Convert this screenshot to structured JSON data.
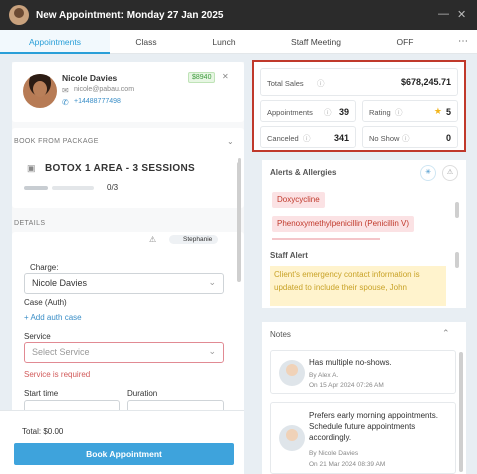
{
  "window": {
    "title": "New Appointment: Monday 27 Jan 2025"
  },
  "tabs": [
    "Appointments",
    "Class",
    "Lunch",
    "Staff Meeting",
    "OFF"
  ],
  "patient": {
    "name": "Nicole Davies",
    "email": "nicole@pabau.com",
    "phone": "+14488777498",
    "balance": "$8940"
  },
  "package": {
    "section_label": "BOOK FROM PACKAGE",
    "name": "BOTOX 1 AREA - 3 SESSIONS",
    "progress_text": "0/3",
    "progress_fraction": 0
  },
  "details": {
    "section_label": "DETAILS",
    "staff": "Stephanie",
    "charge_label": "Charge:",
    "charge_value": "Nicole Davies",
    "case_label": "Case (Auth)",
    "add_case": "+ Add auth case",
    "service_label": "Service",
    "service_placeholder": "Select Service",
    "service_error": "Service is required",
    "start_label": "Start time",
    "duration_label": "Duration"
  },
  "footer": {
    "total": "Total: $0.00",
    "book_button": "Book Appointment"
  },
  "stats": {
    "total_sales_label": "Total Sales",
    "total_sales_value": "$678,245.71",
    "appointments_label": "Appointments",
    "appointments_value": "39",
    "rating_label": "Rating",
    "rating_value": "5",
    "canceled_label": "Canceled",
    "canceled_value": "341",
    "noshow_label": "No Show",
    "noshow_value": "0"
  },
  "alerts": {
    "title": "Alerts & Allergies",
    "items": [
      "Doxycycline",
      "Phenoxymethylpenicillin (Penicillin V)"
    ],
    "staff_alert_title": "Staff Alert",
    "staff_alert_text": "Client's emergency contact information is updated to include their spouse, John"
  },
  "notes": {
    "title": "Notes",
    "items": [
      {
        "text": "Has multiple no-shows.",
        "author": "By Alex A.",
        "date": "On 15 Apr 2024 07:26 AM"
      },
      {
        "text": "Prefers early morning appointments. Schedule future appointments accordingly.",
        "author": "By Nicole Davies",
        "date": "On 21 Mar 2024 08:39 AM"
      }
    ]
  },
  "colors": {
    "accent": "#2a9fd8",
    "button": "#3ea3dc",
    "error": "#c0392b",
    "highlight": "#c0392b",
    "alert_bg": "#fff3cd"
  },
  "icons": [
    "close-icon",
    "minimize-icon",
    "more-icon",
    "email-icon",
    "phone-icon",
    "package-icon",
    "chevron-down-icon",
    "star-icon",
    "info-icon",
    "warning-icon"
  ]
}
